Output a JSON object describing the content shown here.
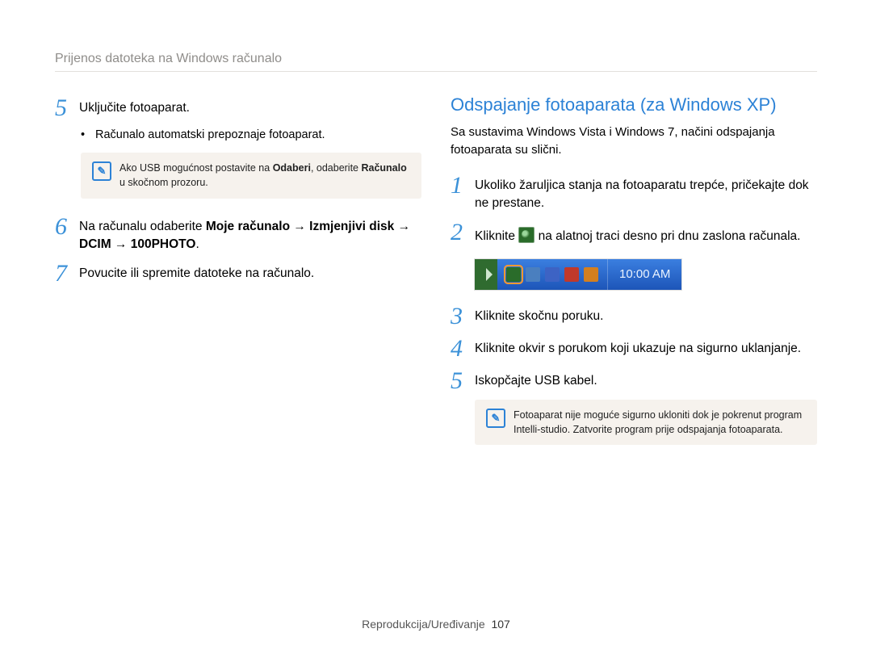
{
  "breadcrumb": "Prijenos datoteka na Windows računalo",
  "left": {
    "steps": [
      {
        "n": "5",
        "body": "Uključite fotoaparat."
      },
      {
        "n": "6",
        "body_parts": [
          "Na računalu odaberite ",
          "Moje računalo",
          " → ",
          "Izmjenjivi disk",
          " → ",
          "DCIM",
          " → ",
          "100PHOTO",
          "."
        ]
      },
      {
        "n": "7",
        "body": "Povucite ili spremite datoteke na računalo."
      }
    ],
    "bullet": "Računalo automatski prepoznaje fotoaparat.",
    "note_parts": [
      "Ako USB mogućnost postavite na ",
      "Odaberi",
      ", odaberite ",
      "Računalo",
      " u skočnom prozoru."
    ]
  },
  "right": {
    "heading": "Odspajanje fotoaparata (za Windows XP)",
    "intro": "Sa sustavima Windows Vista i Windows 7, načini odspajanja fotoaparata su slični.",
    "steps": [
      {
        "n": "1",
        "body": "Ukoliko žaruljica stanja na fotoaparatu trepće, pričekajte dok ne prestane."
      },
      {
        "n": "2",
        "body_pre": "Kliknite ",
        "body_post": " na alatnoj traci desno pri dnu zaslona računala."
      },
      {
        "n": "3",
        "body": "Kliknite skočnu poruku."
      },
      {
        "n": "4",
        "body": "Kliknite okvir s porukom koji ukazuje na sigurno uklanjanje."
      },
      {
        "n": "5",
        "body": "Iskopčajte USB kabel."
      }
    ],
    "taskbar_time": "10:00 AM",
    "note": "Fotoaparat nije moguće sigurno ukloniti dok je pokrenut program Intelli-studio. Zatvorite program prije odspajanja fotoaparata."
  },
  "footer": {
    "section": "Reprodukcija/Uređivanje",
    "page": "107"
  },
  "tray_icons": [
    {
      "name": "safely-remove",
      "hl": true,
      "bg": "#2a6c2a"
    },
    {
      "name": "tray-icon-2",
      "bg": "#4a7fbf"
    },
    {
      "name": "tray-icon-3",
      "bg": "#3d63c4"
    },
    {
      "name": "tray-icon-4",
      "bg": "#c0392b"
    },
    {
      "name": "tray-icon-5",
      "bg": "#d47f1f"
    }
  ]
}
